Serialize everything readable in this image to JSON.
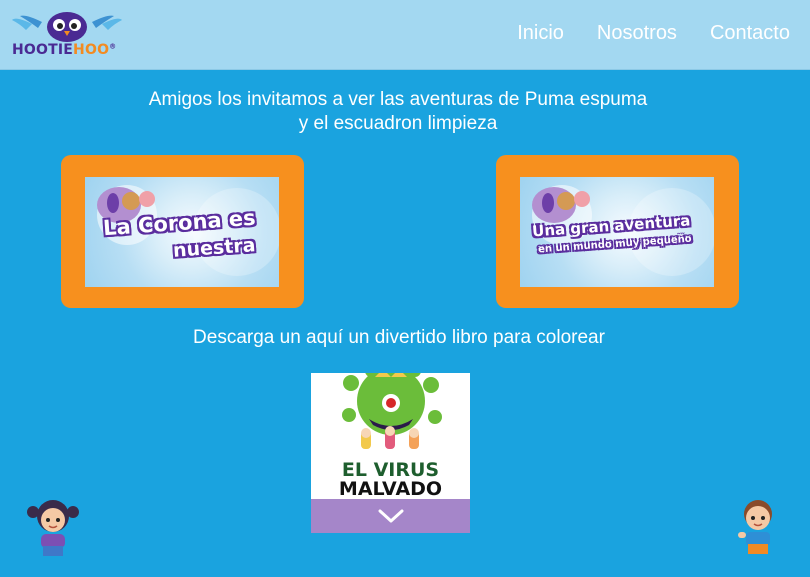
{
  "header": {
    "logo": {
      "part1": "HOOTIE",
      "part2": "HOO",
      "mark": "®"
    },
    "nav": [
      "Inicio",
      "Nosotros",
      "Contacto"
    ]
  },
  "intro": {
    "line1": "Amigos los invitamos a ver las aventuras de Puma espuma",
    "line2": "y el escuadron limpieza"
  },
  "videos": [
    {
      "title_line1": "La Corona es",
      "title_line2": "nuestra"
    },
    {
      "title_line1": "Una gran aventura",
      "title_line2": "en un mundo muy pequeño"
    }
  ],
  "download_text": "Descarga un aquí un divertido libro para colorear",
  "book": {
    "title_line1": "EL VIRUS",
    "title_line2": "MALVADO"
  },
  "colors": {
    "background": "#1aa3df",
    "header": "#a3d8f1",
    "card_frame": "#f7901e",
    "book_bar": "#a586c9",
    "logo_purple": "#4a2a93",
    "logo_orange": "#f28b21"
  },
  "icons": [
    "owl-logo-icon",
    "virus-icon",
    "chevron-down-icon",
    "girl-character-icon",
    "boy-character-icon"
  ]
}
